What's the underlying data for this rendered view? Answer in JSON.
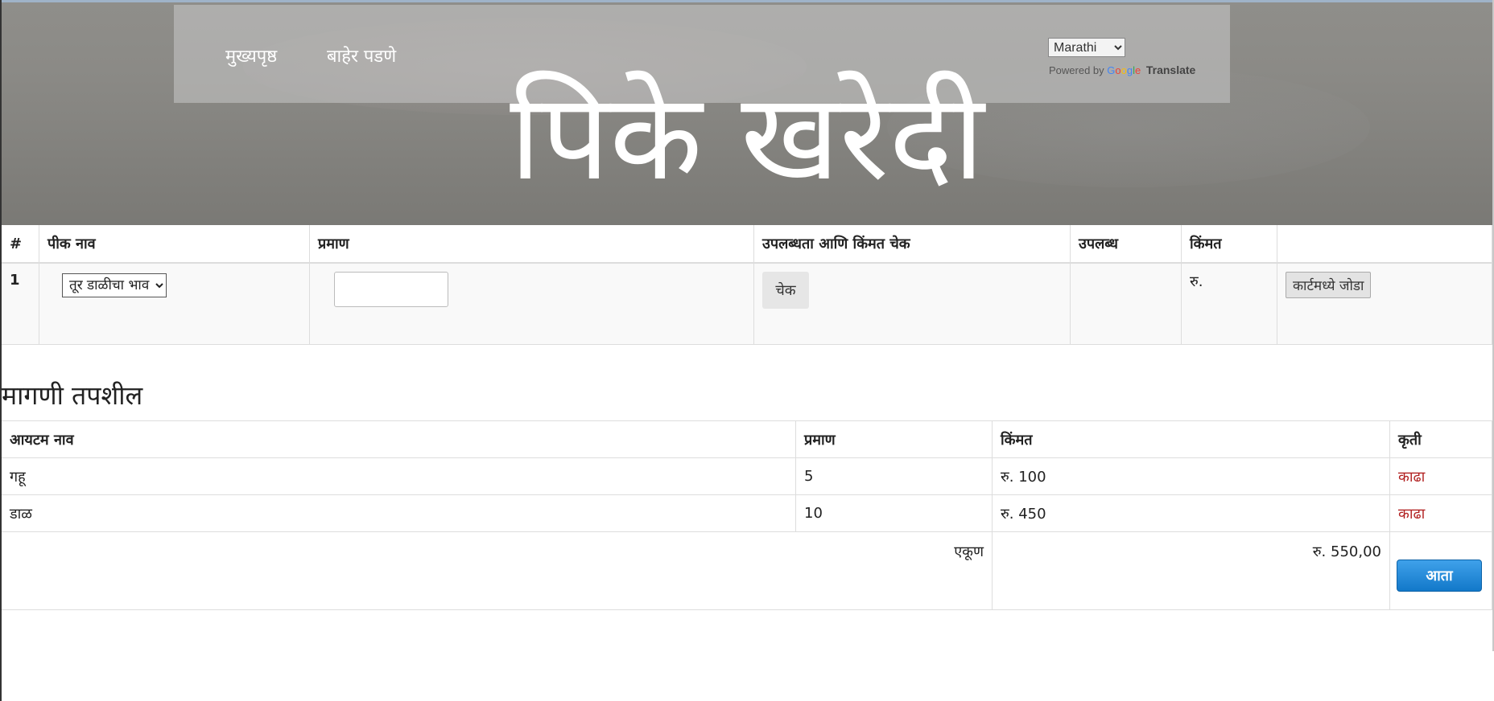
{
  "nav": {
    "home": "मुख्यपृष्ठ",
    "logout": "बाहेर पडणे"
  },
  "translate": {
    "language": "Marathi",
    "powered_by": "Powered by",
    "google": [
      "G",
      "o",
      "o",
      "g",
      "l",
      "e"
    ],
    "translate_label": "Translate"
  },
  "hero": {
    "title": "पिके खरेदी"
  },
  "purchase_table": {
    "headers": [
      "#",
      "पीक नाव",
      "प्रमाण",
      "उपलब्धता आणि किंमत चेक",
      "उपलब्ध",
      "किंमत",
      ""
    ],
    "row": {
      "index": "1",
      "crop_selected": "तूर डाळीचा भाव",
      "quantity": "",
      "check_label": "चेक",
      "available": "",
      "price": "रु.",
      "add_to_cart": "कार्टमध्ये जोडा"
    }
  },
  "order": {
    "title": "मागणी तपशील",
    "headers": [
      "आयटम नाव",
      "प्रमाण",
      "किंमत",
      "कृती"
    ],
    "rows": [
      {
        "name": "गहू",
        "qty": "5",
        "price": "रु. 100",
        "action": "काढा"
      },
      {
        "name": "डाळ",
        "qty": "10",
        "price": "रु. 450",
        "action": "काढा"
      }
    ],
    "total_label": "एकूण",
    "total_value": "रु. 550,00",
    "buy_label": "आता"
  }
}
